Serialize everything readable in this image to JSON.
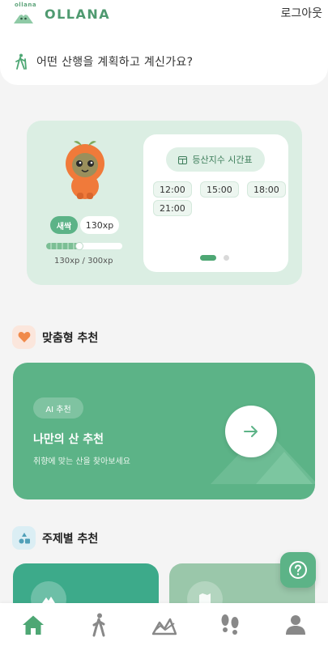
{
  "header": {
    "logo_small": "ollana",
    "logo_text": "OLLANA",
    "logout_label": "로그아웃"
  },
  "prompt": {
    "text": "어떤 산행을 계획하고 계신가요?",
    "icon": "hiker-icon"
  },
  "profile_card": {
    "level_badge": "새싹",
    "xp_pill": "130xp",
    "xp_text": "130xp / 300xp",
    "xp_progress": 0.4333,
    "schedule": {
      "title": "등산지수 시간표",
      "times": [
        "12:00",
        "15:00",
        "18:00",
        "21:00"
      ]
    },
    "pager": {
      "count": 2,
      "active": 0
    }
  },
  "sections": {
    "recommend_title": "맞춤형 추천",
    "theme_title": "주제별 추천"
  },
  "ai_card": {
    "badge": "AI 추천",
    "title": "나만의 산 추천",
    "subtitle": "취향에 맞는 산을 찾아보세요"
  },
  "nav": {
    "items": [
      "home-icon",
      "walker-icon",
      "mountain-chart-icon",
      "footprints-icon",
      "user-icon"
    ],
    "active": "home-icon"
  },
  "colors": {
    "brand": "#4f9a70",
    "accent": "#5cb387",
    "card_bg": "#dbeee3",
    "heart": "#f08a4b",
    "theme_card_1": "#3daa8a",
    "theme_card_2": "#9ac7aa"
  }
}
